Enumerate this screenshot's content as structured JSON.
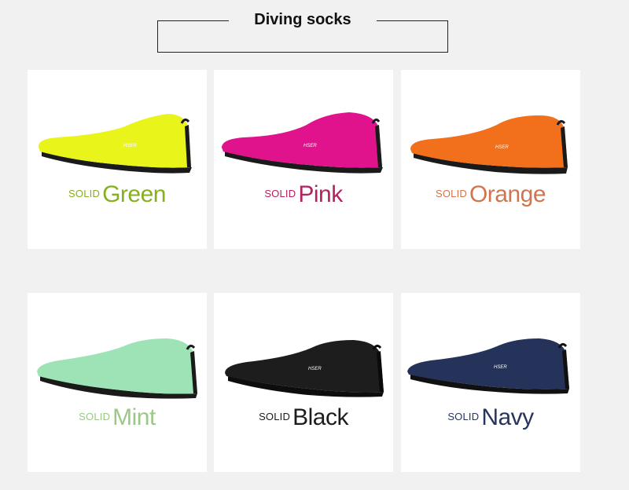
{
  "page": {
    "title": "Diving socks"
  },
  "products": [
    {
      "solid": "SOLID",
      "name": "Green",
      "sock_color": "#e9f51a",
      "text_color": "#86b01f",
      "icon": "sock-icon"
    },
    {
      "solid": "SOLID",
      "name": "Pink",
      "sock_color": "#e0138c",
      "text_color": "#b2245f",
      "icon": "sock-icon"
    },
    {
      "solid": "SOLID",
      "name": "Orange",
      "sock_color": "#f2701c",
      "text_color": "#d0764e",
      "icon": "sock-icon"
    },
    {
      "solid": "SOLID",
      "name": "Mint",
      "sock_color": "#9ee3b6",
      "text_color": "#9bc888",
      "icon": "sock-icon"
    },
    {
      "solid": "SOLID",
      "name": "Black",
      "sock_color": "#1d1d1d",
      "text_color": "#1c1c1c",
      "icon": "sock-icon"
    },
    {
      "solid": "SOLID",
      "name": "Navy",
      "sock_color": "#25335a",
      "text_color": "#27345e",
      "icon": "sock-icon"
    }
  ]
}
